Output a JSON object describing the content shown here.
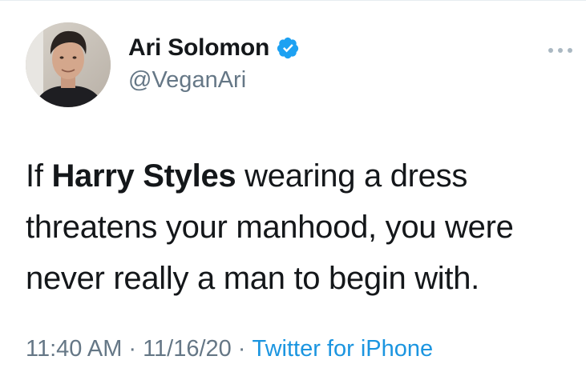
{
  "user": {
    "display_name": "Ari Solomon",
    "handle": "@VeganAri",
    "verified": true
  },
  "tweet": {
    "text_before": "If ",
    "text_bold": "Harry Styles",
    "text_after": " wearing a dress threatens your manhood, you were never really a man to begin with."
  },
  "meta": {
    "time": "11:40 AM",
    "date": "11/16/20",
    "source": "Twitter for iPhone",
    "separator": "·"
  },
  "colors": {
    "text": "#14171a",
    "secondary": "#657786",
    "link": "#1b95e0",
    "verified": "#1da1f2"
  },
  "icons": {
    "verified": "verified-badge-icon",
    "more": "more-options-icon"
  }
}
